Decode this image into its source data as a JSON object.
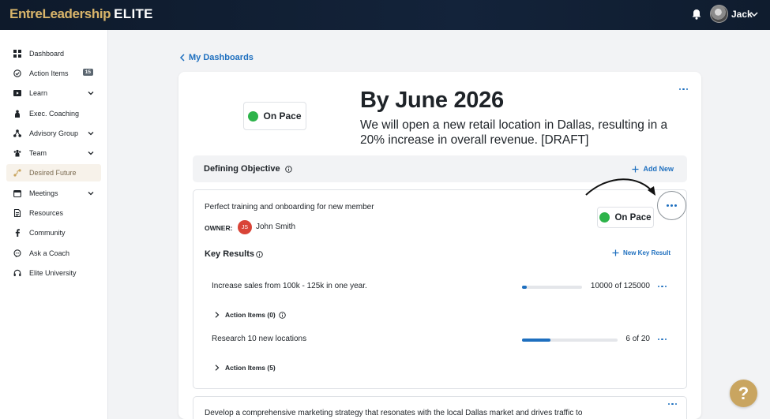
{
  "brand": {
    "part1": "EntreLeadership",
    "part2": "ELITE"
  },
  "user": {
    "name": "Jack"
  },
  "sidebar": {
    "items": [
      {
        "label": "Dashboard",
        "icon": "grid-icon"
      },
      {
        "label": "Action Items",
        "icon": "check-circle-icon",
        "badge": "15"
      },
      {
        "label": "Learn",
        "icon": "play-icon",
        "expandable": true
      },
      {
        "label": "Exec. Coaching",
        "icon": "coaching-icon"
      },
      {
        "label": "Advisory Group",
        "icon": "network-icon",
        "expandable": true
      },
      {
        "label": "Team",
        "icon": "team-icon",
        "expandable": true
      },
      {
        "label": "Desired Future",
        "icon": "route-icon",
        "active": true
      },
      {
        "label": "Meetings",
        "icon": "calendar-icon",
        "expandable": true
      },
      {
        "label": "Resources",
        "icon": "document-icon"
      },
      {
        "label": "Community",
        "icon": "facebook-icon"
      },
      {
        "label": "Ask a Coach",
        "icon": "chat-icon"
      },
      {
        "label": "Elite University",
        "icon": "headset-icon"
      }
    ]
  },
  "breadcrumb": {
    "back_label": "My Dashboards"
  },
  "goal": {
    "status": "On Pace",
    "status_color": "#2db34a",
    "headline": "By June 2026",
    "description": "We will open a new retail location in Dallas, resulting in a 20% increase in overall revenue. [DRAFT]"
  },
  "defining_objective": {
    "title": "Defining Objective",
    "add_label": "Add New"
  },
  "objective": {
    "text": "Perfect training and onboarding for new member",
    "owner_label": "OWNER:",
    "owner_initials": "JS",
    "owner_name": "John Smith",
    "status": "On Pace"
  },
  "key_results": {
    "title": "Key Results",
    "new_label": "New Key Result",
    "rows": [
      {
        "text": "Increase sales from 100k - 125k in one year.",
        "value": "10000 of 125000",
        "progress": 0.08,
        "action_items": "Action Items (0)"
      },
      {
        "text": "Research 10 new locations",
        "value": "6 of 20",
        "progress": 0.3,
        "action_items": "Action Items (5)"
      }
    ]
  },
  "objective2": {
    "text": "Develop a comprehensive marketing strategy that resonates with the local Dallas market and drives traffic to"
  },
  "colors": {
    "accent": "#1e6fbf",
    "gold": "#c9a560",
    "topbar": "#0e1a2b"
  }
}
